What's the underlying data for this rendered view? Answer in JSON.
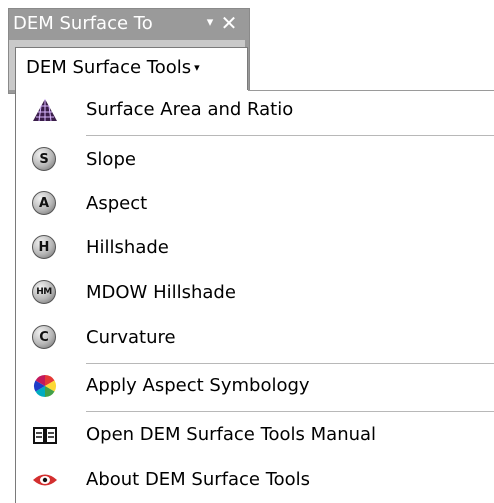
{
  "toolbar": {
    "title": "DEM Surface To",
    "dropdown_glyph": "▾",
    "close_glyph": "✕",
    "menu_label": "DEM Surface Tools",
    "menu_caret": "▾"
  },
  "menu": {
    "items": [
      {
        "label": "Surface Area and Ratio",
        "icon": "surface-mesh-icon"
      },
      {
        "label": "Slope",
        "icon": "slope-s-icon",
        "badge": "S"
      },
      {
        "label": "Aspect",
        "icon": "aspect-a-icon",
        "badge": "A"
      },
      {
        "label": "Hillshade",
        "icon": "hillshade-h-icon",
        "badge": "H"
      },
      {
        "label": "MDOW Hillshade",
        "icon": "mdow-hillshade-icon",
        "badge": "HM"
      },
      {
        "label": "Curvature",
        "icon": "curvature-c-icon",
        "badge": "C"
      },
      {
        "label": "Apply Aspect Symbology",
        "icon": "color-wheel-icon"
      },
      {
        "label": "Open DEM Surface Tools Manual",
        "icon": "open-book-icon"
      },
      {
        "label": "About DEM Surface Tools",
        "icon": "red-eye-icon"
      }
    ]
  },
  "colors": {
    "title_bar": "#9a9a9a",
    "toolbar_body": "#c9c9c9",
    "menu_background": "#ffffff",
    "separator": "#b8b8b8"
  }
}
